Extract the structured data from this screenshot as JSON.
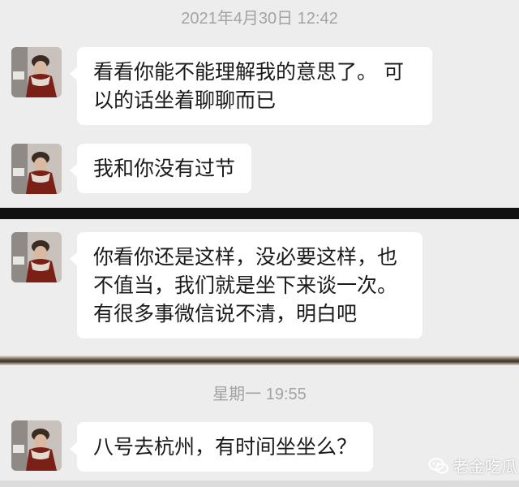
{
  "chat": {
    "timestamp_top": "2021年4月30日 12:42",
    "timestamp_bottom": "星期一 19:55",
    "messages": [
      {
        "sender": "contact",
        "text": "看看你能不能理解我的意思了。 可\n以的话坐着聊聊而已"
      },
      {
        "sender": "contact",
        "text": "我和你没有过节"
      },
      {
        "sender": "contact",
        "text": "你看你还是这样，没必要这样，也\n不值当，我们就是坐下来谈一次。\n有很多事微信说不清，明白吧"
      },
      {
        "sender": "contact",
        "text": "八号去杭州，有时间坐坐么？"
      }
    ]
  },
  "watermark": {
    "text": "老金吃瓜",
    "icon": "wechat-official-account-icon"
  },
  "colors": {
    "background": "#ededed",
    "bubble": "#ffffff",
    "timestamp": "#a3a3a3"
  }
}
